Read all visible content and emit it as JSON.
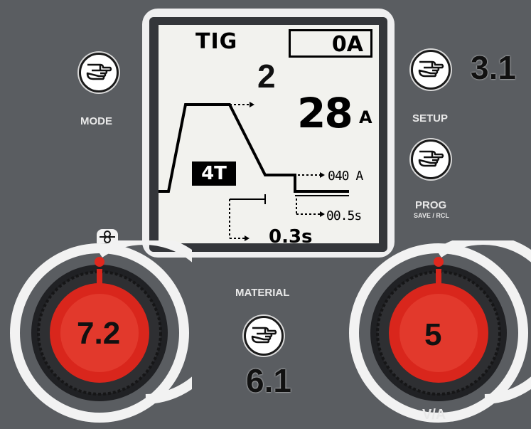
{
  "display": {
    "process": "TIG",
    "boxed_current": "0A",
    "current_value": "28",
    "current_unit": "A",
    "trigger_mode": "4T",
    "final_current": "040 A",
    "downslope_time": "00.5s",
    "preflow_time": "0.3s"
  },
  "buttons": {
    "mode": {
      "label": "MODE",
      "icon": "hand-pointer-icon"
    },
    "setup": {
      "label": "SETUP",
      "icon": "hand-pointer-icon"
    },
    "prog": {
      "label": "PROG",
      "sublabel": "SAVE / RCL",
      "icon": "hand-pointer-icon"
    },
    "material": {
      "label": "MATERIAL",
      "icon": "hand-pointer-icon"
    }
  },
  "knobs": {
    "left": {
      "icon": "adjust-symbol-icon",
      "callout": "7.2"
    },
    "right": {
      "label": "V/A",
      "callout": "5"
    }
  },
  "callouts": {
    "display": "2",
    "setup": "3.1",
    "material": "6.1"
  },
  "colors": {
    "panel": "#5a5d61",
    "knob_red": "#d9261c",
    "indicator_dot": "#e0281e"
  }
}
